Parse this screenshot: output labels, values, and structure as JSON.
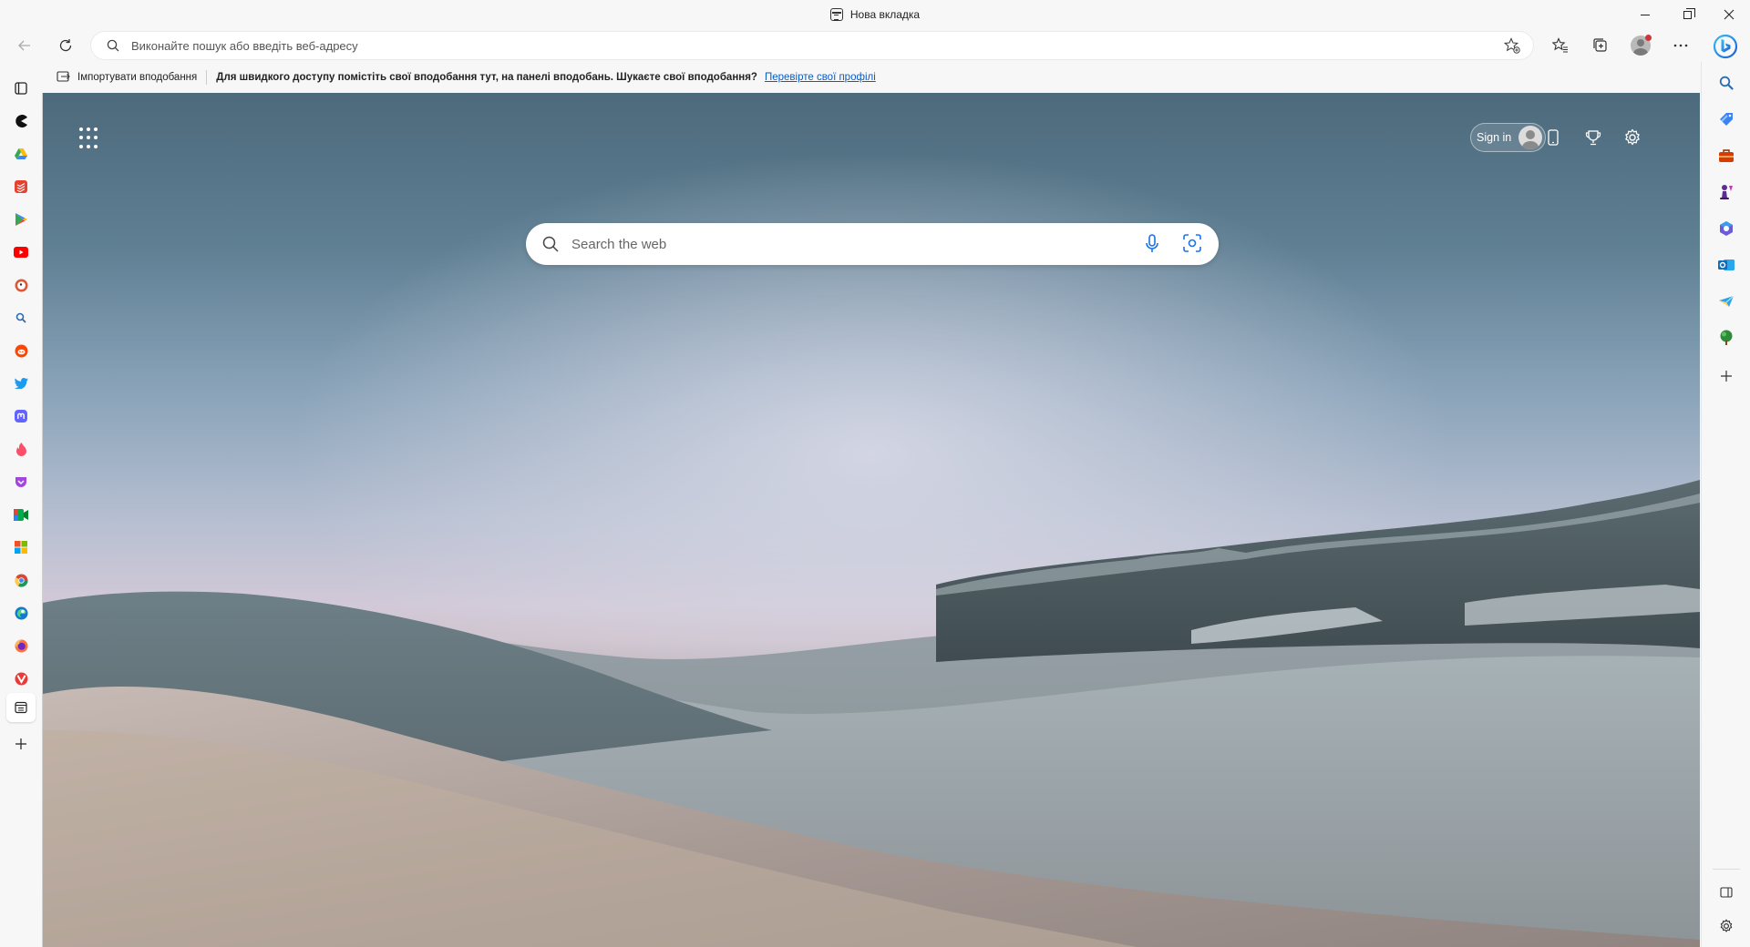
{
  "window": {
    "tab_title": "Нова вкладка"
  },
  "toolbar": {
    "address_placeholder": "Виконайте пошук або введіть веб-адресу"
  },
  "favorites_bar": {
    "import_label": "Імпортувати вподобання",
    "message": "Для швидкого доступу помістіть свої вподобання тут, на панелі вподобань. Шукаєте свої вподобання?",
    "link_label": "Перевірте свої профілі"
  },
  "left_sidebar": {
    "items": [
      {
        "icon": "tab-actions-icon"
      },
      {
        "icon": "pacman-icon",
        "color": "#111111"
      },
      {
        "icon": "google-drive-icon",
        "color": "#fbbc04"
      },
      {
        "icon": "todoist-icon",
        "color": "#e44332"
      },
      {
        "icon": "google-play-icon",
        "color": "#34a853"
      },
      {
        "icon": "youtube-icon",
        "color": "#ff0000"
      },
      {
        "icon": "duckduckgo-icon",
        "color": "#de5833"
      },
      {
        "icon": "search-icon",
        "color": "#2b6cb0"
      },
      {
        "icon": "reddit-icon",
        "color": "#ff4500"
      },
      {
        "icon": "twitter-icon",
        "color": "#1d9bf0"
      },
      {
        "icon": "mastodon-icon",
        "color": "#6364ff"
      },
      {
        "icon": "tinder-icon",
        "color": "#fd5068"
      },
      {
        "icon": "pocket-icon",
        "color": "#a346e0"
      },
      {
        "icon": "google-meet-icon",
        "color": "#00ac47"
      },
      {
        "icon": "microsoft-icon",
        "color": "#f25022"
      },
      {
        "icon": "chrome-icon",
        "color": "#db4437"
      },
      {
        "icon": "edge-icon",
        "color": "#0c7bd0"
      },
      {
        "icon": "firefox-icon",
        "color": "#ff7139"
      },
      {
        "icon": "vivaldi-icon",
        "color": "#ef3939"
      },
      {
        "icon": "new-tab-icon"
      },
      {
        "icon": "add-tab-icon"
      }
    ]
  },
  "new_tab": {
    "sign_in_label": "Sign in",
    "search_placeholder": "Search the web"
  },
  "right_sidebar": {
    "items": [
      {
        "icon": "search-icon",
        "color": "#2b6cb0"
      },
      {
        "icon": "shopping-tag-icon",
        "color": "#3b82f6"
      },
      {
        "icon": "tools-icon",
        "color": "#d83b01"
      },
      {
        "icon": "games-icon",
        "color": "#5c2d91"
      },
      {
        "icon": "microsoft-365-icon",
        "color": "#6b5bd6"
      },
      {
        "icon": "outlook-icon",
        "color": "#0f6cbd"
      },
      {
        "icon": "drop-icon",
        "color": "#2fa3e6"
      },
      {
        "icon": "tree-icon",
        "color": "#2e8b3a"
      },
      {
        "icon": "add-icon"
      }
    ]
  }
}
